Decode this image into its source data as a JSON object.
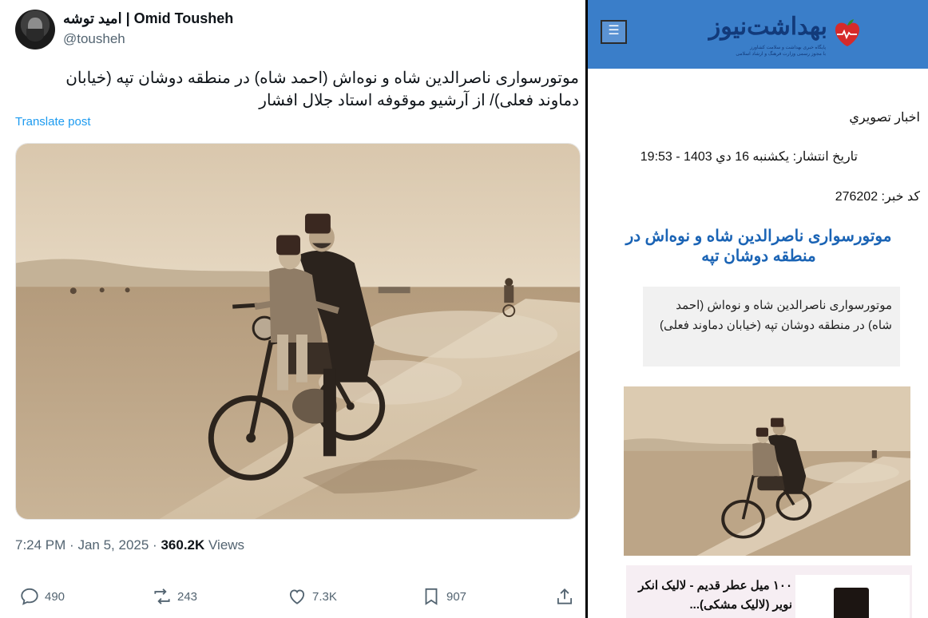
{
  "tweet": {
    "display_name": "امید توشه | Omid Tousheh",
    "handle": "@tousheh",
    "text": "موتورسواری ناصرالدین شاه و نوه‌اش (احمد شاه) در منطقه دوشان تپه (خیابان دماوند فعلی)/ از آرشیو موقوفه استاد جلال افشار",
    "translate_label": "Translate post",
    "time": "7:24 PM",
    "date": "Jan 5, 2025",
    "views_count": "360.2K",
    "views_label": "Views",
    "separator": "·",
    "image_icon": "sepia-photo-motorcycle-riders",
    "actions": {
      "reply_count": "490",
      "repost_count": "243",
      "like_count": "7.3K",
      "bookmark_count": "907"
    },
    "icons": {
      "reply": "reply-icon",
      "repost": "repost-icon",
      "like": "heart-icon",
      "bookmark": "bookmark-icon",
      "share": "share-icon"
    }
  },
  "site": {
    "menu_glyph": "☰",
    "logo_text": "بهداشت‌نیوز",
    "logo_sub1": "پایگاه خبری بهداشت و سلامت کشاورز",
    "logo_sub2": "با مجوز رسمی وزارت فرهنگ و ارشاد اسلامی",
    "category": "اخبار تصويري",
    "pub_date": "تاریخ انتشار: یکشنبه 16 دي 1403 - 19:53",
    "news_code": "کد خبر: 276202",
    "headline": "موتورسواری ناصرالدین شاه و نوه‌اش در منطقه دوشان تپه",
    "lead": "موتورسواری ناصرالدین شاه و نوه‌اش (احمد شاه) در منطقه دوشان تپه (خیابان دماوند فعلی)",
    "ad_text": "۱۰۰ میل عطر قدیم - لالیک انکر نویر (لالیک مشکی)...",
    "header_color": "#3a7ec9",
    "headline_color": "#1b64b5"
  }
}
